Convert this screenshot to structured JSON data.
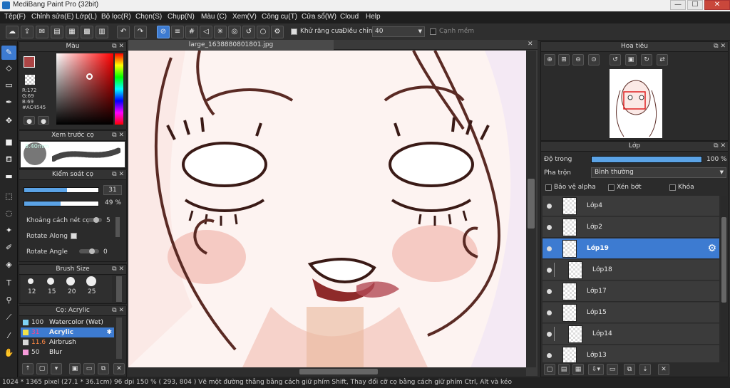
{
  "window": {
    "title": "MediBang Paint Pro (32bit)",
    "minimize": "—",
    "maximize": "☐",
    "close": "✕"
  },
  "menu": [
    "Tệp(F)",
    "Chỉnh sửa(E)",
    "Lớp(L)",
    "Bộ lọc(R)",
    "Chọn(S)",
    "Chụp(N)",
    "Màu (C)",
    "Xem(V)",
    "Công cụ(T)",
    "Cửa sổ(W)",
    "Cloud",
    "Help"
  ],
  "toolbar": {
    "antialias_label": "Khử răng cưa",
    "adjust_label": "Điều chỉnh",
    "adjust_value": "40",
    "smooth_label": "Cạnh mềm"
  },
  "color_panel": {
    "title": "Màu",
    "r": "R:172",
    "g": "G:69",
    "b": "B:69",
    "hex": "#AC4545",
    "fg": "#ac4545"
  },
  "brush_preview": {
    "title": "Xem trước cọ",
    "size": "8.40mm"
  },
  "brush_control": {
    "title": "Kiểm soát cọ",
    "size_value": "31",
    "opacity_value": "49 %",
    "spacing_label": "Khoảng cách nét cọ",
    "spacing_value": "5",
    "rotate_along_label": "Rotate Along",
    "rotate_angle_label": "Rotate Angle",
    "rotate_angle_value": "0"
  },
  "brush_size": {
    "title": "Brush Size",
    "sizes": [
      "12",
      "15",
      "20",
      "25"
    ]
  },
  "brush_list": {
    "title": "Cọ: Acrylic",
    "items": [
      {
        "size": "100",
        "name": "Watercolor (Wet)",
        "color": "#7fd3f5"
      },
      {
        "size": "31",
        "name": "Acrylic",
        "color": "#f2e24a"
      },
      {
        "size": "11.6",
        "name": "Airbrush",
        "color": "#d9d9d9"
      },
      {
        "size": "50",
        "name": "Blur",
        "color": "#f59ad9"
      }
    ]
  },
  "document": {
    "tab": "large_1638880801801.jpg"
  },
  "navigator": {
    "title": "Hoa tiêu"
  },
  "layers": {
    "title": "Lớp",
    "opacity_label": "Độ trong",
    "opacity_value": "100 %",
    "blend_label": "Pha trộn",
    "blend_value": "Bình thường",
    "protect_alpha": "Bảo vệ alpha",
    "clipping": "Xén bớt",
    "lock": "Khóa",
    "items": [
      "Lớp4",
      "Lớp2",
      "Lớp19",
      "Lớp18",
      "Lớp17",
      "Lớp15",
      "Lớp14",
      "Lớp13"
    ]
  },
  "status": {
    "text": "1024 * 1365 pixel   (27.1 * 36.1cm)   96 dpi   150 %   ( 293, 804 )   Vẽ một đường thẳng bằng cách giữ phím Shift, Thay đổi cỡ cọ bằng cách giữ phím Ctrl, Alt và kéo"
  }
}
